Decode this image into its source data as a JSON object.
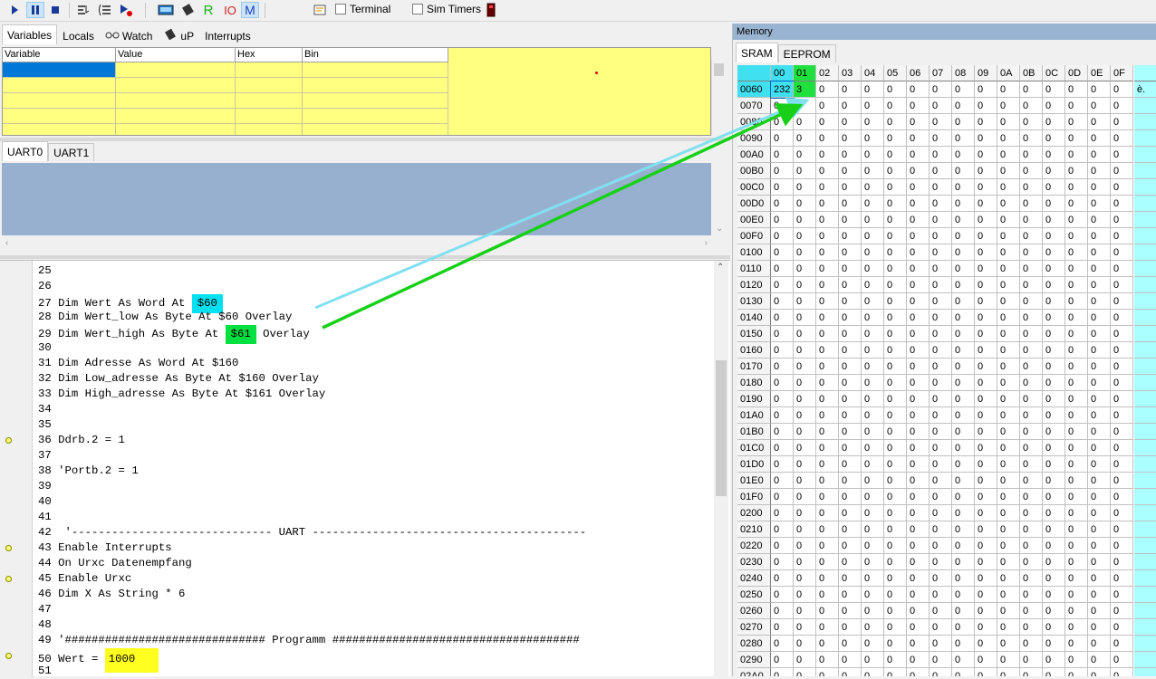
{
  "toolbar": {
    "buttons": [
      "run-icon",
      "pause-icon",
      "stop-icon",
      "step-into-icon",
      "step-over-icon",
      "run-to-icon",
      "lcd-icon",
      "chip-icon",
      "R",
      "IO",
      "M",
      "terminal-app-icon"
    ],
    "terminal_label": "Terminal",
    "sim_timers_label": "Sim Timers"
  },
  "var_tabs": [
    "Variables",
    "Locals",
    "Watch",
    "uP",
    "Interrupts"
  ],
  "var_columns": [
    "Variable",
    "Value",
    "Hex",
    "Bin"
  ],
  "uart_tabs": [
    "UART0",
    "UART1"
  ],
  "memory": {
    "title": "Memory",
    "tabs": [
      "SRAM",
      "EEPROM"
    ],
    "columns": [
      "00",
      "01",
      "02",
      "03",
      "04",
      "05",
      "06",
      "07",
      "08",
      "09",
      "0A",
      "0B",
      "0C",
      "0D",
      "0E",
      "0F"
    ],
    "rows": [
      {
        "addr": "0060",
        "vals": [
          "232",
          "3",
          "0",
          "0",
          "0",
          "0",
          "0",
          "0",
          "0",
          "0",
          "0",
          "0",
          "0",
          "0",
          "0",
          "0"
        ],
        "ascii": "è."
      },
      {
        "addr": "0070",
        "vals": [
          "0",
          "0",
          "0",
          "0",
          "0",
          "0",
          "0",
          "0",
          "0",
          "0",
          "0",
          "0",
          "0",
          "0",
          "0",
          "0"
        ],
        "ascii": ""
      },
      {
        "addr": "0080",
        "vals": [
          "0",
          "0",
          "0",
          "0",
          "0",
          "0",
          "0",
          "0",
          "0",
          "0",
          "0",
          "0",
          "0",
          "0",
          "0",
          "0"
        ],
        "ascii": ""
      },
      {
        "addr": "0090",
        "vals": [
          "0",
          "0",
          "0",
          "0",
          "0",
          "0",
          "0",
          "0",
          "0",
          "0",
          "0",
          "0",
          "0",
          "0",
          "0",
          "0"
        ],
        "ascii": ""
      },
      {
        "addr": "00A0",
        "vals": [
          "0",
          "0",
          "0",
          "0",
          "0",
          "0",
          "0",
          "0",
          "0",
          "0",
          "0",
          "0",
          "0",
          "0",
          "0",
          "0"
        ],
        "ascii": ""
      },
      {
        "addr": "00B0",
        "vals": [
          "0",
          "0",
          "0",
          "0",
          "0",
          "0",
          "0",
          "0",
          "0",
          "0",
          "0",
          "0",
          "0",
          "0",
          "0",
          "0"
        ],
        "ascii": ""
      },
      {
        "addr": "00C0",
        "vals": [
          "0",
          "0",
          "0",
          "0",
          "0",
          "0",
          "0",
          "0",
          "0",
          "0",
          "0",
          "0",
          "0",
          "0",
          "0",
          "0"
        ],
        "ascii": ""
      },
      {
        "addr": "00D0",
        "vals": [
          "0",
          "0",
          "0",
          "0",
          "0",
          "0",
          "0",
          "0",
          "0",
          "0",
          "0",
          "0",
          "0",
          "0",
          "0",
          "0"
        ],
        "ascii": ""
      },
      {
        "addr": "00E0",
        "vals": [
          "0",
          "0",
          "0",
          "0",
          "0",
          "0",
          "0",
          "0",
          "0",
          "0",
          "0",
          "0",
          "0",
          "0",
          "0",
          "0"
        ],
        "ascii": ""
      },
      {
        "addr": "00F0",
        "vals": [
          "0",
          "0",
          "0",
          "0",
          "0",
          "0",
          "0",
          "0",
          "0",
          "0",
          "0",
          "0",
          "0",
          "0",
          "0",
          "0"
        ],
        "ascii": ""
      },
      {
        "addr": "0100",
        "vals": [
          "0",
          "0",
          "0",
          "0",
          "0",
          "0",
          "0",
          "0",
          "0",
          "0",
          "0",
          "0",
          "0",
          "0",
          "0",
          "0"
        ],
        "ascii": ""
      },
      {
        "addr": "0110",
        "vals": [
          "0",
          "0",
          "0",
          "0",
          "0",
          "0",
          "0",
          "0",
          "0",
          "0",
          "0",
          "0",
          "0",
          "0",
          "0",
          "0"
        ],
        "ascii": ""
      },
      {
        "addr": "0120",
        "vals": [
          "0",
          "0",
          "0",
          "0",
          "0",
          "0",
          "0",
          "0",
          "0",
          "0",
          "0",
          "0",
          "0",
          "0",
          "0",
          "0"
        ],
        "ascii": ""
      },
      {
        "addr": "0130",
        "vals": [
          "0",
          "0",
          "0",
          "0",
          "0",
          "0",
          "0",
          "0",
          "0",
          "0",
          "0",
          "0",
          "0",
          "0",
          "0",
          "0"
        ],
        "ascii": ""
      },
      {
        "addr": "0140",
        "vals": [
          "0",
          "0",
          "0",
          "0",
          "0",
          "0",
          "0",
          "0",
          "0",
          "0",
          "0",
          "0",
          "0",
          "0",
          "0",
          "0"
        ],
        "ascii": ""
      },
      {
        "addr": "0150",
        "vals": [
          "0",
          "0",
          "0",
          "0",
          "0",
          "0",
          "0",
          "0",
          "0",
          "0",
          "0",
          "0",
          "0",
          "0",
          "0",
          "0"
        ],
        "ascii": ""
      },
      {
        "addr": "0160",
        "vals": [
          "0",
          "0",
          "0",
          "0",
          "0",
          "0",
          "0",
          "0",
          "0",
          "0",
          "0",
          "0",
          "0",
          "0",
          "0",
          "0"
        ],
        "ascii": ""
      },
      {
        "addr": "0170",
        "vals": [
          "0",
          "0",
          "0",
          "0",
          "0",
          "0",
          "0",
          "0",
          "0",
          "0",
          "0",
          "0",
          "0",
          "0",
          "0",
          "0"
        ],
        "ascii": ""
      },
      {
        "addr": "0180",
        "vals": [
          "0",
          "0",
          "0",
          "0",
          "0",
          "0",
          "0",
          "0",
          "0",
          "0",
          "0",
          "0",
          "0",
          "0",
          "0",
          "0"
        ],
        "ascii": ""
      },
      {
        "addr": "0190",
        "vals": [
          "0",
          "0",
          "0",
          "0",
          "0",
          "0",
          "0",
          "0",
          "0",
          "0",
          "0",
          "0",
          "0",
          "0",
          "0",
          "0"
        ],
        "ascii": ""
      },
      {
        "addr": "01A0",
        "vals": [
          "0",
          "0",
          "0",
          "0",
          "0",
          "0",
          "0",
          "0",
          "0",
          "0",
          "0",
          "0",
          "0",
          "0",
          "0",
          "0"
        ],
        "ascii": ""
      },
      {
        "addr": "01B0",
        "vals": [
          "0",
          "0",
          "0",
          "0",
          "0",
          "0",
          "0",
          "0",
          "0",
          "0",
          "0",
          "0",
          "0",
          "0",
          "0",
          "0"
        ],
        "ascii": ""
      },
      {
        "addr": "01C0",
        "vals": [
          "0",
          "0",
          "0",
          "0",
          "0",
          "0",
          "0",
          "0",
          "0",
          "0",
          "0",
          "0",
          "0",
          "0",
          "0",
          "0"
        ],
        "ascii": ""
      },
      {
        "addr": "01D0",
        "vals": [
          "0",
          "0",
          "0",
          "0",
          "0",
          "0",
          "0",
          "0",
          "0",
          "0",
          "0",
          "0",
          "0",
          "0",
          "0",
          "0"
        ],
        "ascii": ""
      },
      {
        "addr": "01E0",
        "vals": [
          "0",
          "0",
          "0",
          "0",
          "0",
          "0",
          "0",
          "0",
          "0",
          "0",
          "0",
          "0",
          "0",
          "0",
          "0",
          "0"
        ],
        "ascii": ""
      },
      {
        "addr": "01F0",
        "vals": [
          "0",
          "0",
          "0",
          "0",
          "0",
          "0",
          "0",
          "0",
          "0",
          "0",
          "0",
          "0",
          "0",
          "0",
          "0",
          "0"
        ],
        "ascii": ""
      },
      {
        "addr": "0200",
        "vals": [
          "0",
          "0",
          "0",
          "0",
          "0",
          "0",
          "0",
          "0",
          "0",
          "0",
          "0",
          "0",
          "0",
          "0",
          "0",
          "0"
        ],
        "ascii": ""
      },
      {
        "addr": "0210",
        "vals": [
          "0",
          "0",
          "0",
          "0",
          "0",
          "0",
          "0",
          "0",
          "0",
          "0",
          "0",
          "0",
          "0",
          "0",
          "0",
          "0"
        ],
        "ascii": ""
      },
      {
        "addr": "0220",
        "vals": [
          "0",
          "0",
          "0",
          "0",
          "0",
          "0",
          "0",
          "0",
          "0",
          "0",
          "0",
          "0",
          "0",
          "0",
          "0",
          "0"
        ],
        "ascii": ""
      },
      {
        "addr": "0230",
        "vals": [
          "0",
          "0",
          "0",
          "0",
          "0",
          "0",
          "0",
          "0",
          "0",
          "0",
          "0",
          "0",
          "0",
          "0",
          "0",
          "0"
        ],
        "ascii": ""
      },
      {
        "addr": "0240",
        "vals": [
          "0",
          "0",
          "0",
          "0",
          "0",
          "0",
          "0",
          "0",
          "0",
          "0",
          "0",
          "0",
          "0",
          "0",
          "0",
          "0"
        ],
        "ascii": ""
      },
      {
        "addr": "0250",
        "vals": [
          "0",
          "0",
          "0",
          "0",
          "0",
          "0",
          "0",
          "0",
          "0",
          "0",
          "0",
          "0",
          "0",
          "0",
          "0",
          "0"
        ],
        "ascii": ""
      },
      {
        "addr": "0260",
        "vals": [
          "0",
          "0",
          "0",
          "0",
          "0",
          "0",
          "0",
          "0",
          "0",
          "0",
          "0",
          "0",
          "0",
          "0",
          "0",
          "0"
        ],
        "ascii": ""
      },
      {
        "addr": "0270",
        "vals": [
          "0",
          "0",
          "0",
          "0",
          "0",
          "0",
          "0",
          "0",
          "0",
          "0",
          "0",
          "0",
          "0",
          "0",
          "0",
          "0"
        ],
        "ascii": ""
      },
      {
        "addr": "0280",
        "vals": [
          "0",
          "0",
          "0",
          "0",
          "0",
          "0",
          "0",
          "0",
          "0",
          "0",
          "0",
          "0",
          "0",
          "0",
          "0",
          "0"
        ],
        "ascii": ""
      },
      {
        "addr": "0290",
        "vals": [
          "0",
          "0",
          "0",
          "0",
          "0",
          "0",
          "0",
          "0",
          "0",
          "0",
          "0",
          "0",
          "0",
          "0",
          "0",
          "0"
        ],
        "ascii": ""
      },
      {
        "addr": "02A0",
        "vals": [
          "0",
          "0",
          "0",
          "0",
          "0",
          "0",
          "0",
          "0",
          "0",
          "0",
          "0",
          "0",
          "0",
          "0",
          "0",
          "0"
        ],
        "ascii": ""
      }
    ]
  },
  "code": {
    "lines": [
      {
        "n": "25",
        "t": "",
        "bp": false
      },
      {
        "n": "26",
        "t": "",
        "bp": false
      },
      {
        "n": "27",
        "t": "Dim Wert As Word At ",
        "hl": "$60",
        "hlc": "#00e0f0",
        "post": "",
        "bp": false
      },
      {
        "n": "28",
        "t": "Dim Wert_low As Byte At $60 Overlay",
        "bp": false
      },
      {
        "n": "29",
        "t": "Dim Wert_high As Byte At ",
        "hl": "$61",
        "hlc": "#00e040",
        "post": " Overlay",
        "bp": false
      },
      {
        "n": "30",
        "t": "",
        "bp": false
      },
      {
        "n": "31",
        "t": "Dim Adresse As Word At $160",
        "bp": false
      },
      {
        "n": "32",
        "t": "Dim Low_adresse As Byte At $160 Overlay",
        "bp": false
      },
      {
        "n": "33",
        "t": "Dim High_adresse As Byte At $161 Overlay",
        "bp": false
      },
      {
        "n": "34",
        "t": "",
        "bp": false
      },
      {
        "n": "35",
        "t": "",
        "bp": false
      },
      {
        "n": "36",
        "t": "Ddrb.2 = 1",
        "bp": true
      },
      {
        "n": "37",
        "t": "",
        "bp": false
      },
      {
        "n": "38",
        "t": "'Portb.2 = 1",
        "bp": false
      },
      {
        "n": "39",
        "t": "",
        "bp": false
      },
      {
        "n": "40",
        "t": "",
        "bp": false
      },
      {
        "n": "41",
        "t": "",
        "bp": false
      },
      {
        "n": "42",
        "t": " '------------------------------ UART -----------------------------------------",
        "bp": false
      },
      {
        "n": "43",
        "t": "Enable Interrupts",
        "bp": true
      },
      {
        "n": "44",
        "t": "On Urxc Datenempfang",
        "bp": false
      },
      {
        "n": "45",
        "t": "Enable Urxc",
        "bp": true
      },
      {
        "n": "46",
        "t": "Dim X As String * 6",
        "bp": false
      },
      {
        "n": "47",
        "t": "",
        "bp": false
      },
      {
        "n": "48",
        "t": "",
        "bp": false
      },
      {
        "n": "49",
        "t": "'############################## Programm #####################################",
        "bp": false
      },
      {
        "n": "50",
        "t": "Wert = ",
        "hl": "1000",
        "hlc": "#ffff20",
        "post": "",
        "bp": true
      },
      {
        "n": "51",
        "t": "",
        "bp": false
      }
    ]
  },
  "colors": {
    "accent_cyan": "#00e0f0",
    "accent_green": "#00e040",
    "var_bg": "#ffff80",
    "uart_bg": "#98b0d0",
    "mem_title": "#99b4d1"
  }
}
